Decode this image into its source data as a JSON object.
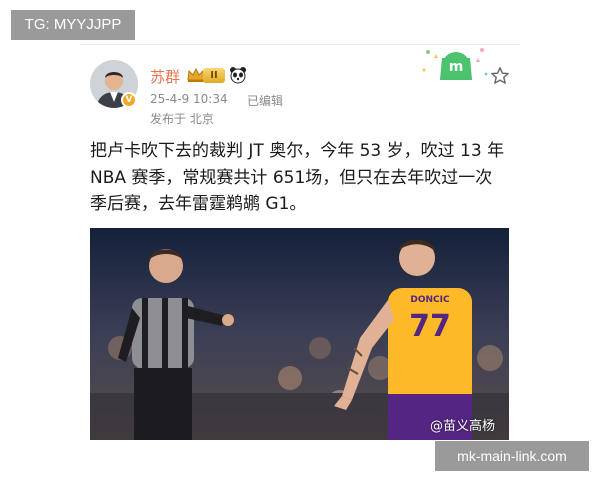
{
  "overlay": {
    "tg_label": "TG: MYYJJPP",
    "link_label": "mk-main-link.com"
  },
  "post": {
    "author": "苏群",
    "level_badge": "II",
    "avatar_badge": "V",
    "time": "25-4-9 10:34",
    "edited": "已编辑",
    "location": "发布于 北京",
    "text_lines": [
      "把卢卡吹下去的裁判 JT 奥尔，今年 53 岁，吹过 13 年",
      "NBA 赛季，常规赛共计 651场，但只在去年吹过一次",
      "季后赛，去年雷霆鹈鹕 G1。"
    ],
    "image": {
      "jersey_name": "DONCIC",
      "jersey_number": "77",
      "watermark": "@苗义高杨"
    }
  },
  "icons": {
    "star": "star-outline-icon",
    "deco": "sticker-deco-icon",
    "crown": "crown-badge-icon",
    "panda": "panda-badge-icon"
  },
  "colors": {
    "username": "#eb7350",
    "meta": "#8a8a8a",
    "overlay_bg": "#9a9a9a",
    "lakers_gold": "#fdb927",
    "lakers_purple": "#552583"
  }
}
